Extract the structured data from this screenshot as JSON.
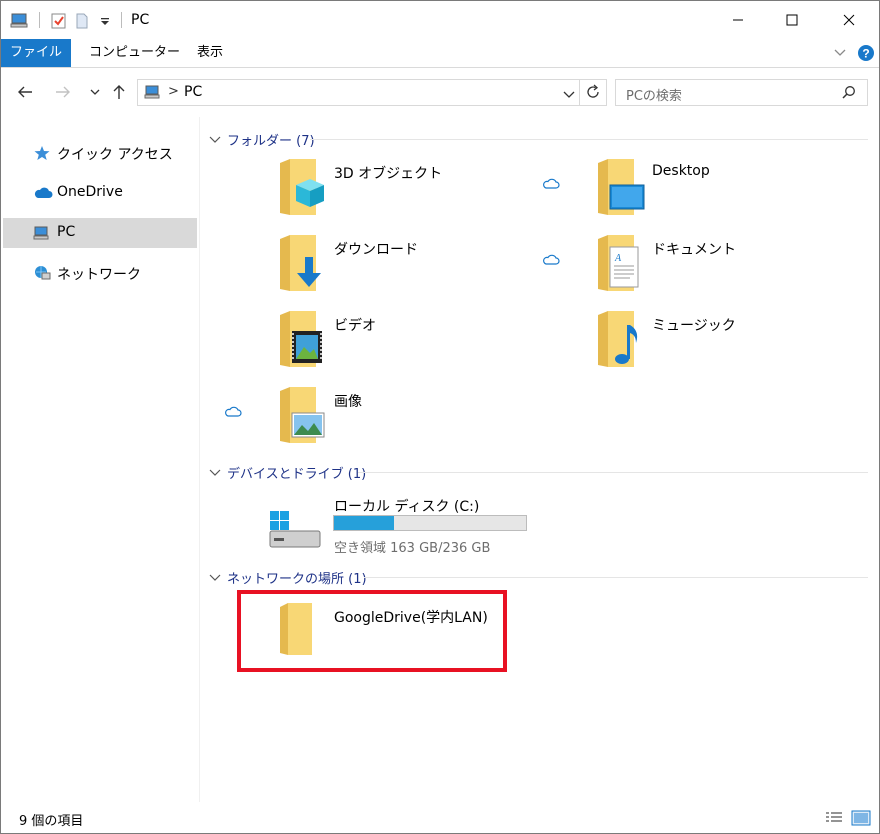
{
  "window": {
    "title": "PC",
    "minimize_icon": "minimize-icon",
    "maximize_icon": "maximize-icon",
    "close_icon": "close-icon"
  },
  "ribbon": {
    "tabs": [
      {
        "label": "ファイル",
        "active": true
      },
      {
        "label": "コンピューター",
        "active": false
      },
      {
        "label": "表示",
        "active": false
      }
    ]
  },
  "address": {
    "path": "PC",
    "separator": ">"
  },
  "search": {
    "placeholder": "PCの検索"
  },
  "nav": {
    "items": [
      {
        "label": "クイック アクセス",
        "icon": "star-icon",
        "selected": false
      },
      {
        "label": "OneDrive",
        "icon": "cloud-icon",
        "selected": false
      },
      {
        "label": "PC",
        "icon": "pc-icon",
        "selected": true
      },
      {
        "label": "ネットワーク",
        "icon": "network-icon",
        "selected": false
      }
    ]
  },
  "groups": {
    "folders": {
      "header": "フォルダー (7)",
      "items": [
        {
          "label": "3D オブジェクト",
          "icon": "3d-objects-folder-icon",
          "cloud": false
        },
        {
          "label": "Desktop",
          "icon": "desktop-folder-icon",
          "cloud": true
        },
        {
          "label": "ダウンロード",
          "icon": "downloads-folder-icon",
          "cloud": false
        },
        {
          "label": "ドキュメント",
          "icon": "documents-folder-icon",
          "cloud": true
        },
        {
          "label": "ビデオ",
          "icon": "videos-folder-icon",
          "cloud": false
        },
        {
          "label": "ミュージック",
          "icon": "music-folder-icon",
          "cloud": false
        },
        {
          "label": "画像",
          "icon": "pictures-folder-icon",
          "cloud": true
        }
      ]
    },
    "devices": {
      "header": "デバイスとドライブ (1)",
      "drive": {
        "label": "ローカル ディスク (C:)",
        "free_text": "空き領域 163 GB/236 GB",
        "used_fraction": 0.31
      }
    },
    "network": {
      "header": "ネットワークの場所 (1)",
      "items": [
        {
          "label": "GoogleDrive(学内LAN)",
          "icon": "network-folder-icon"
        }
      ]
    }
  },
  "status": {
    "count": "9 個の項目"
  },
  "colors": {
    "accent": "#1979ca",
    "group_header": "#1e3287",
    "highlight": "#e81123",
    "drive_fill": "#26a0da",
    "folder": "#f8d775",
    "cloud": "#1979ca"
  }
}
